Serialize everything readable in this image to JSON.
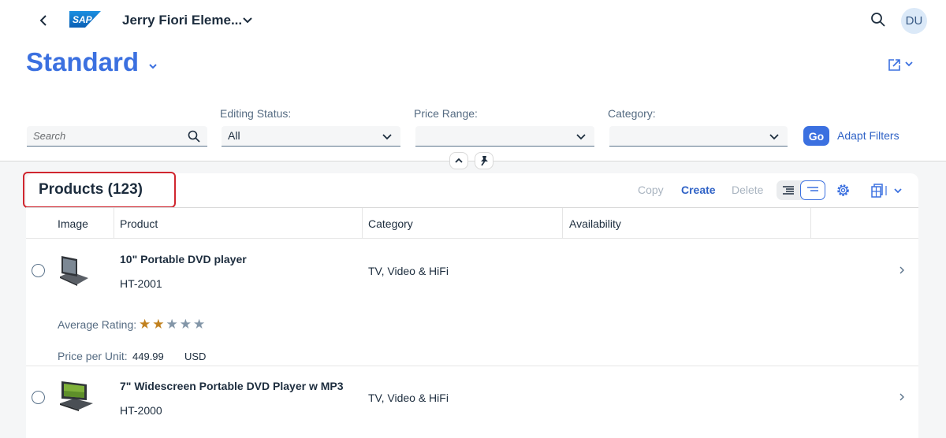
{
  "shell": {
    "app_title": "Jerry Fiori Eleme...",
    "logo_text": "SAP",
    "avatar_initials": "DU"
  },
  "header": {
    "variant_name": "Standard"
  },
  "filters": {
    "search": {
      "placeholder": "Search"
    },
    "editing_status": {
      "label": "Editing Status:",
      "value": "All"
    },
    "price_range": {
      "label": "Price Range:",
      "value": ""
    },
    "category": {
      "label": "Category:",
      "value": ""
    },
    "go_label": "Go",
    "adapt_label": "Adapt Filters"
  },
  "table": {
    "title": "Products (123)",
    "toolbar": {
      "copy": "Copy",
      "create": "Create",
      "delete": "Delete"
    },
    "columns": [
      "Image",
      "Product",
      "Category",
      "Availability"
    ],
    "rows": [
      {
        "name": "10\" Portable DVD player",
        "id": "HT-2001",
        "category": "TV, Video & HiFi",
        "rating_label": "Average Rating:",
        "rating": 2,
        "rating_max": 5,
        "price_label": "Price per Unit:",
        "price": "449.99",
        "currency": "USD"
      },
      {
        "name": "7\" Widescreen Portable DVD Player w MP3",
        "id": "HT-2000",
        "category": "TV, Video & HiFi"
      }
    ]
  },
  "colors": {
    "accent": "#3b70e0",
    "highlight_border": "#d0262f",
    "star_filled": "#c1811f",
    "star_empty": "#8396a8"
  }
}
